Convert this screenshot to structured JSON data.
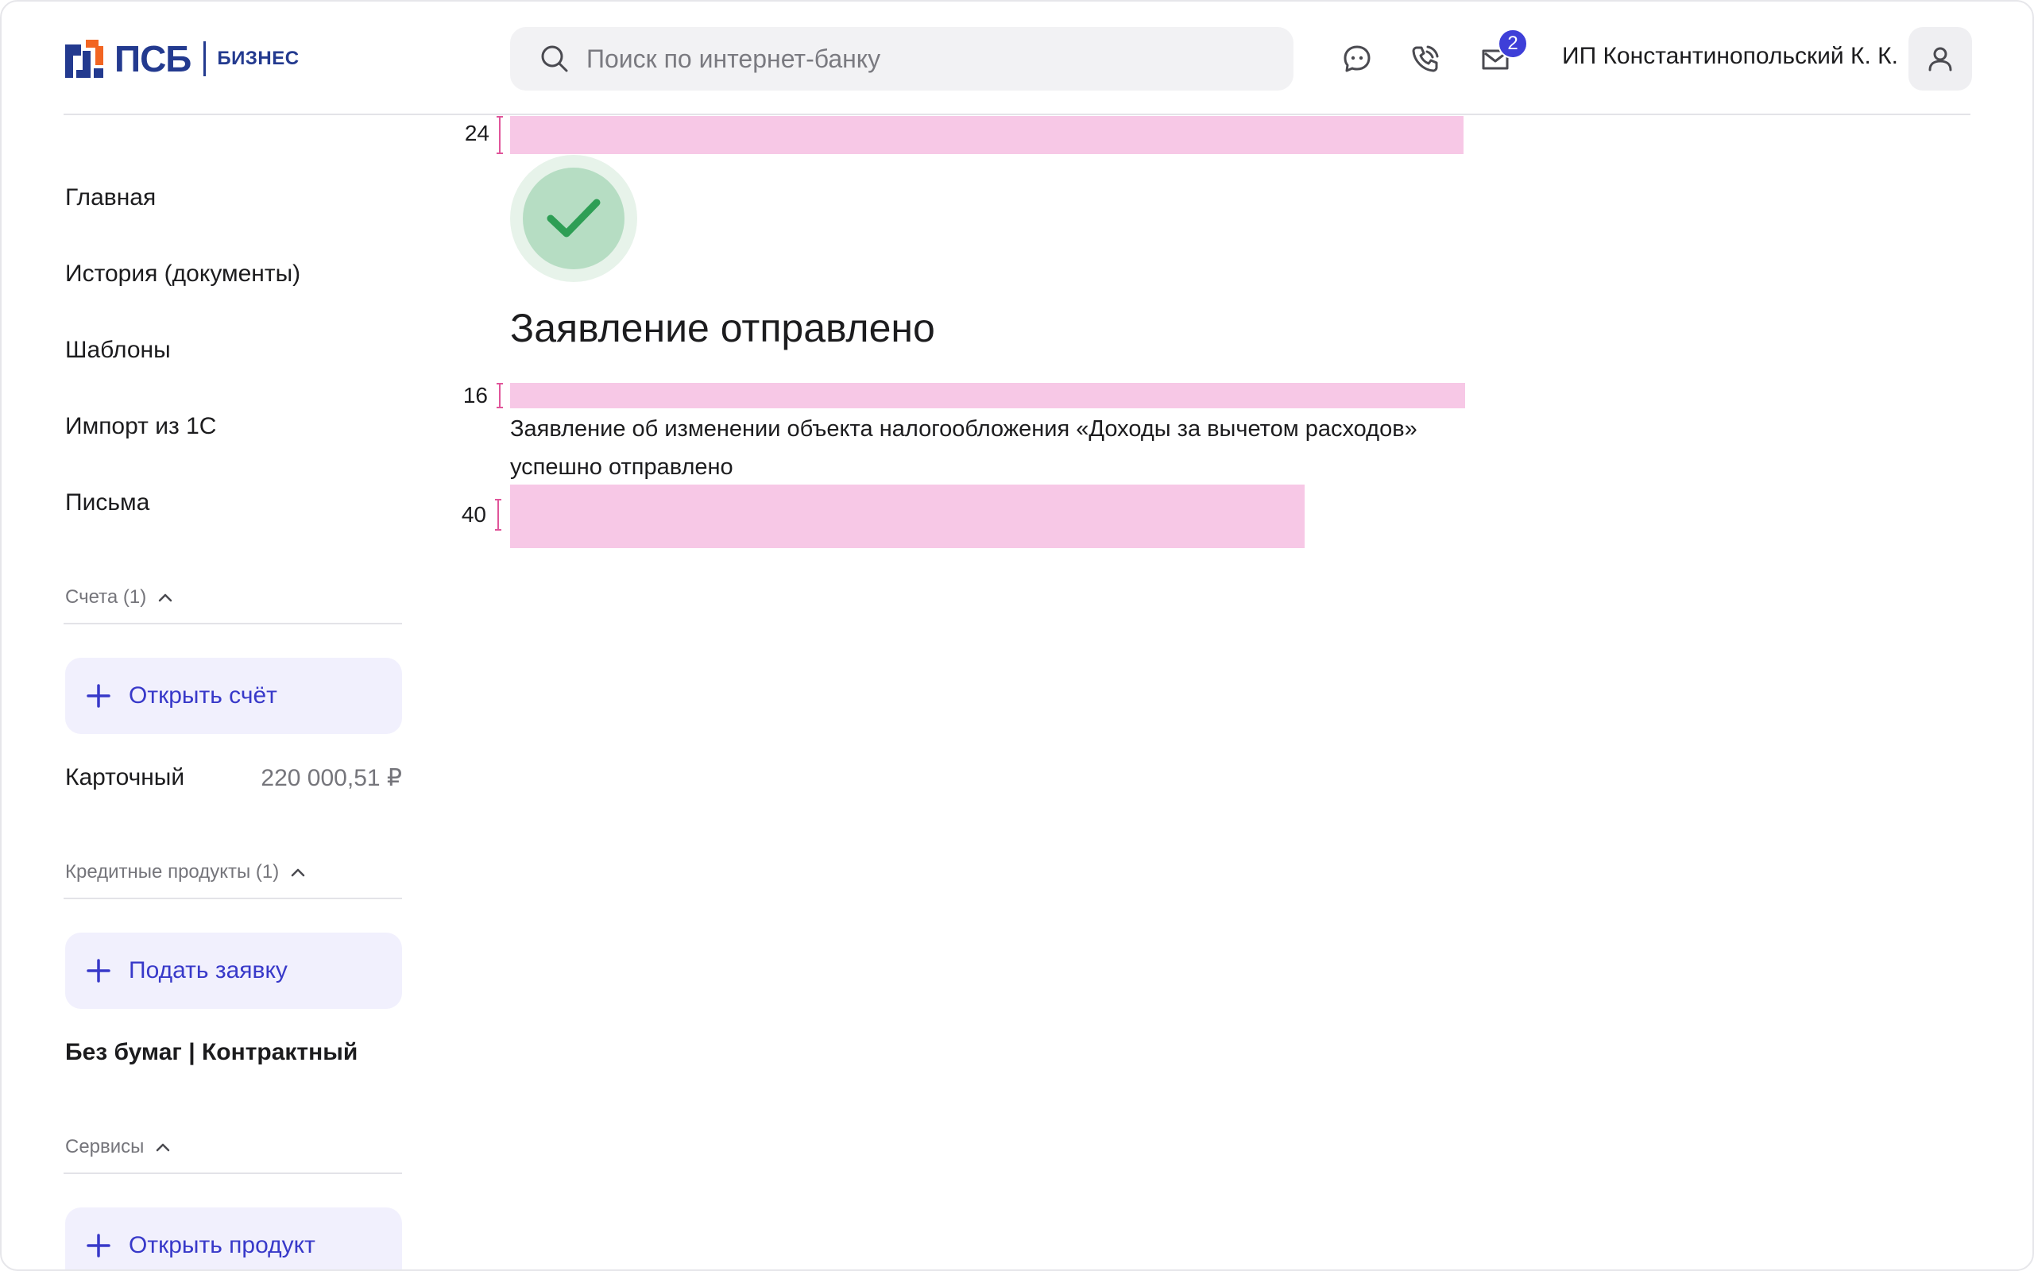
{
  "header": {
    "logo_name": "ПСБ",
    "logo_sub": "БИЗНЕС",
    "search_placeholder": "Поиск по интернет-банку",
    "notifications_count": "2",
    "user_name": "ИП Константинопольский К. К."
  },
  "sidebar": {
    "nav": [
      "Главная",
      "История (документы)",
      "Шаблоны",
      "Импорт из 1С",
      "Письма"
    ],
    "accounts": {
      "title": "Счета (1)",
      "add_label": "Открыть счёт",
      "items": [
        {
          "name": "Карточный",
          "amount": "220 000,51 ₽"
        }
      ]
    },
    "credit": {
      "title": "Кредитные продукты (1)",
      "add_label": "Подать заявку",
      "items": [
        {
          "name": "Без бумаг | Контрактный"
        }
      ]
    },
    "services": {
      "title": "Сервисы",
      "add_label": "Открыть продукт"
    }
  },
  "main": {
    "spacers": [
      "24",
      "16",
      "40"
    ],
    "title": "Заявление отправлено",
    "description": "Заявление об изменении объекта налогообложения «Доходы за вычетом расходов» успешно отправлено"
  },
  "colors": {
    "brand": "#233a8f",
    "accent": "#3839c9",
    "logo_orange": "#f26522",
    "success": "#2e9e55",
    "spacer": "#f7c8e6"
  }
}
